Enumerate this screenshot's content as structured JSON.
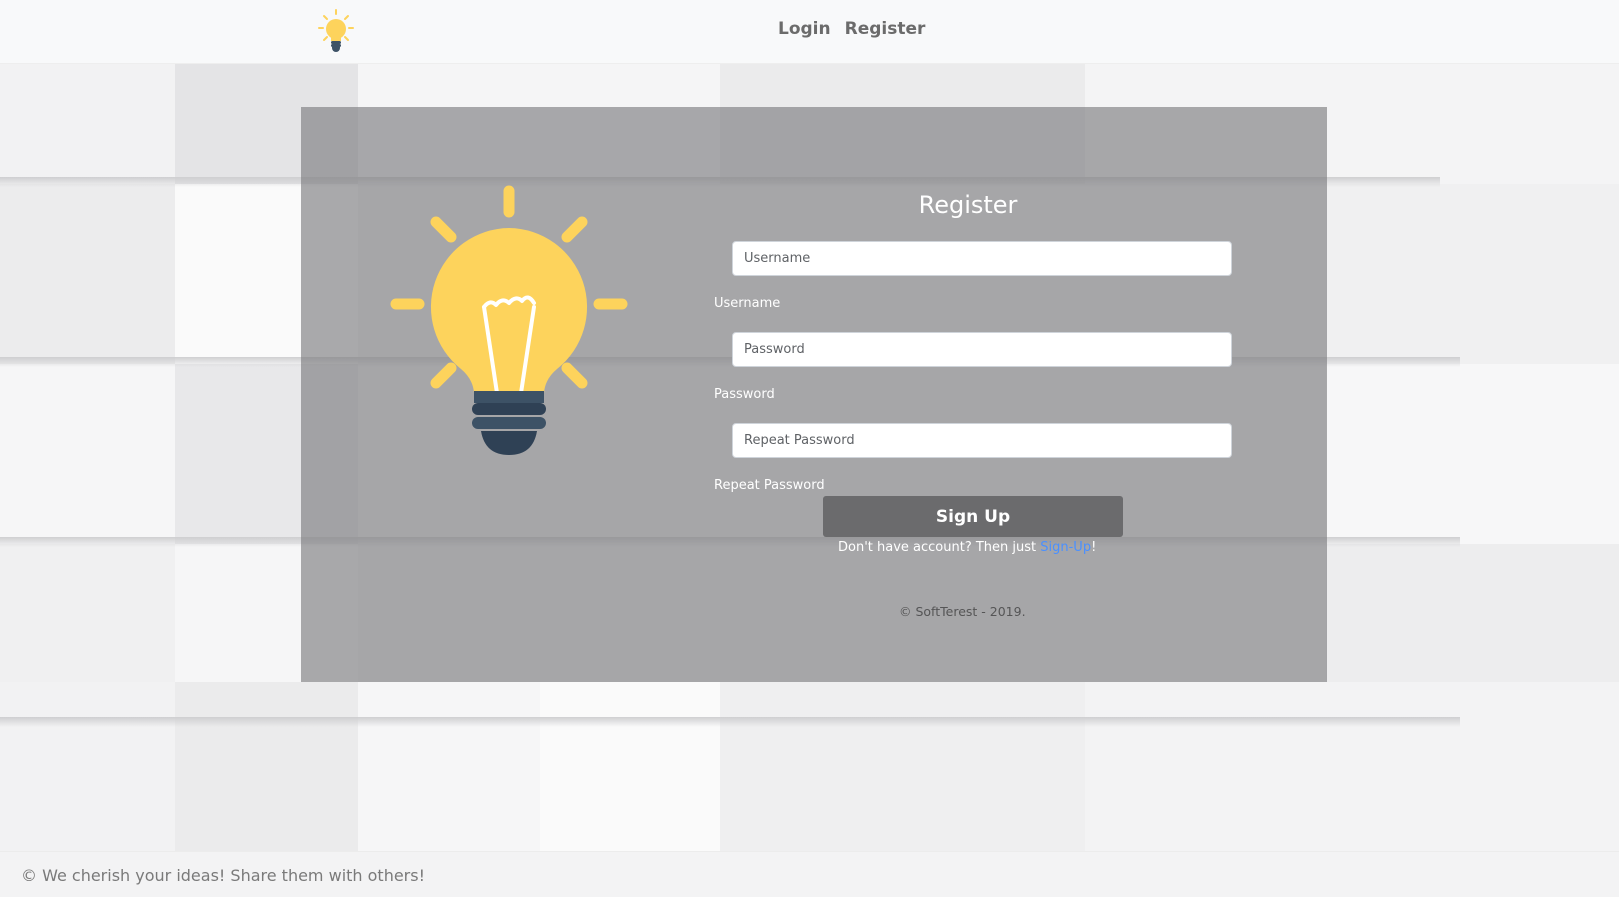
{
  "nav": {
    "logo_icon": "lightbulb-icon",
    "links": [
      {
        "label": "Login"
      },
      {
        "label": "Register"
      }
    ]
  },
  "form": {
    "title": "Register",
    "fields": [
      {
        "placeholder": "Username",
        "value": "",
        "label": "Username"
      },
      {
        "placeholder": "Password",
        "value": "",
        "label": "Password"
      },
      {
        "placeholder": "Repeat Password",
        "value": "",
        "label": "Repeat Password"
      }
    ],
    "submit_label": "Sign Up",
    "prompt_text": "Don't have account? Then just ",
    "prompt_link": "Sign-Up",
    "prompt_suffix": "!",
    "copyright": "© SoftTerest - 2019."
  },
  "illustration": {
    "icon": "lightbulb-icon",
    "bulb_color": "#FDD35C",
    "base_color": "#3D5266"
  },
  "footer": {
    "text": "© We cherish your ideas! Share them with others!"
  },
  "colors": {
    "link": "#4a90ff",
    "button": "#6b6b6d"
  }
}
